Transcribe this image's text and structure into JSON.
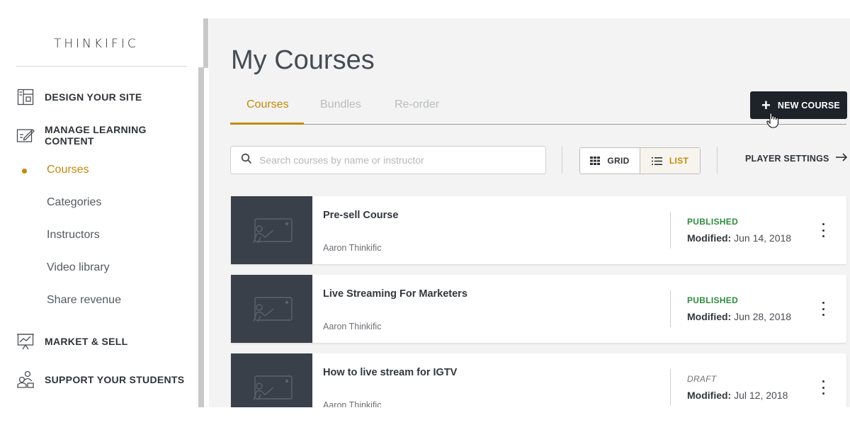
{
  "brand": {
    "logo_text": "THINKIFIC"
  },
  "sidebar": {
    "sections": [
      {
        "label": "DESIGN YOUR SITE",
        "icon": "layout-icon"
      },
      {
        "label": "MANAGE LEARNING CONTENT",
        "icon": "edit-content-icon"
      },
      {
        "label": "MARKET & SELL",
        "icon": "chart-board-icon"
      },
      {
        "label": "SUPPORT YOUR STUDENTS",
        "icon": "users-icon"
      }
    ],
    "sub_items": [
      {
        "label": "Courses",
        "active": true
      },
      {
        "label": "Categories",
        "active": false
      },
      {
        "label": "Instructors",
        "active": false
      },
      {
        "label": "Video library",
        "active": false
      },
      {
        "label": "Share revenue",
        "active": false
      }
    ]
  },
  "main": {
    "title": "My Courses",
    "tabs": [
      {
        "label": "Courses",
        "active": true
      },
      {
        "label": "Bundles",
        "active": false
      },
      {
        "label": "Re-order",
        "active": false
      }
    ],
    "new_course_label": "NEW COURSE",
    "search": {
      "placeholder": "Search courses by name or instructor",
      "value": ""
    },
    "view_toggle": {
      "grid_label": "GRID",
      "list_label": "LIST",
      "selected": "LIST"
    },
    "player_settings_label": "PLAYER SETTINGS",
    "courses": [
      {
        "title": "Pre-sell Course",
        "author": "Aaron Thinkific",
        "status": "PUBLISHED",
        "modified_label": "Modified:",
        "modified_date": "Jun 14, 2018"
      },
      {
        "title": "Live Streaming For Marketers",
        "author": "Aaron Thinkific",
        "status": "PUBLISHED",
        "modified_label": "Modified:",
        "modified_date": "Jun 28, 2018"
      },
      {
        "title": "How to live stream for IGTV",
        "author": "Aaron Thinkific",
        "status": "DRAFT",
        "modified_label": "Modified:",
        "modified_date": "Jul 12, 2018"
      }
    ]
  },
  "colors": {
    "accent": "#c68a0a",
    "published": "#2e8b3d",
    "button_dark": "#1e2329",
    "thumbnail": "#394049",
    "main_bg": "#f3f3f3"
  }
}
